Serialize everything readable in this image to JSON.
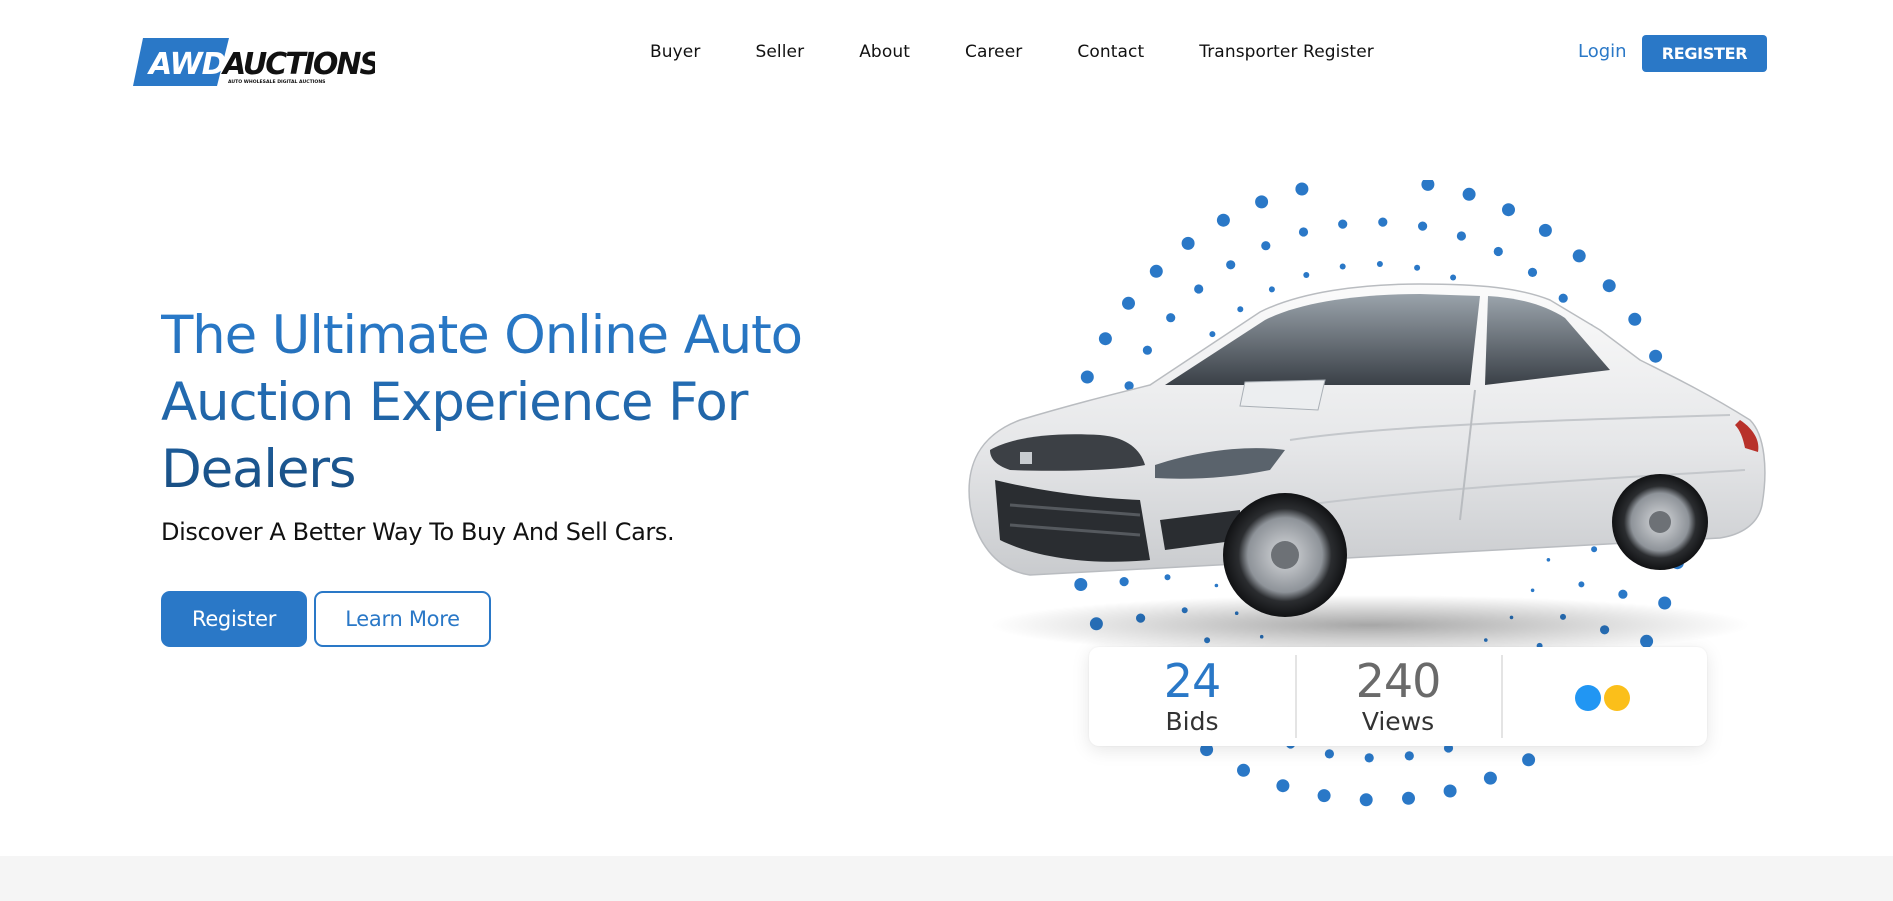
{
  "brand": {
    "logo_main": "AWD AUCTIONS",
    "logo_tagline": "AUTO WHOLESALE DIGITAL AUCTIONS",
    "accent_color": "#2a78c7"
  },
  "nav": {
    "items": [
      {
        "label": "Buyer"
      },
      {
        "label": "Seller"
      },
      {
        "label": "About"
      },
      {
        "label": "Career"
      },
      {
        "label": "Contact"
      },
      {
        "label": "Transporter Register"
      }
    ],
    "login_label": "Login",
    "register_label": "REGISTER"
  },
  "hero": {
    "title": "The Ultimate Online Auto Auction Experience For Dealers",
    "subtitle": "Discover A Better Way To Buy And Sell Cars.",
    "register_label": "Register",
    "learn_more_label": "Learn More"
  },
  "stats": {
    "bids_value": "24",
    "bids_label": "Bids",
    "views_value": "240",
    "views_label": "Views",
    "indicator_colors": [
      "#2196f3",
      "#fbbf1a"
    ]
  }
}
